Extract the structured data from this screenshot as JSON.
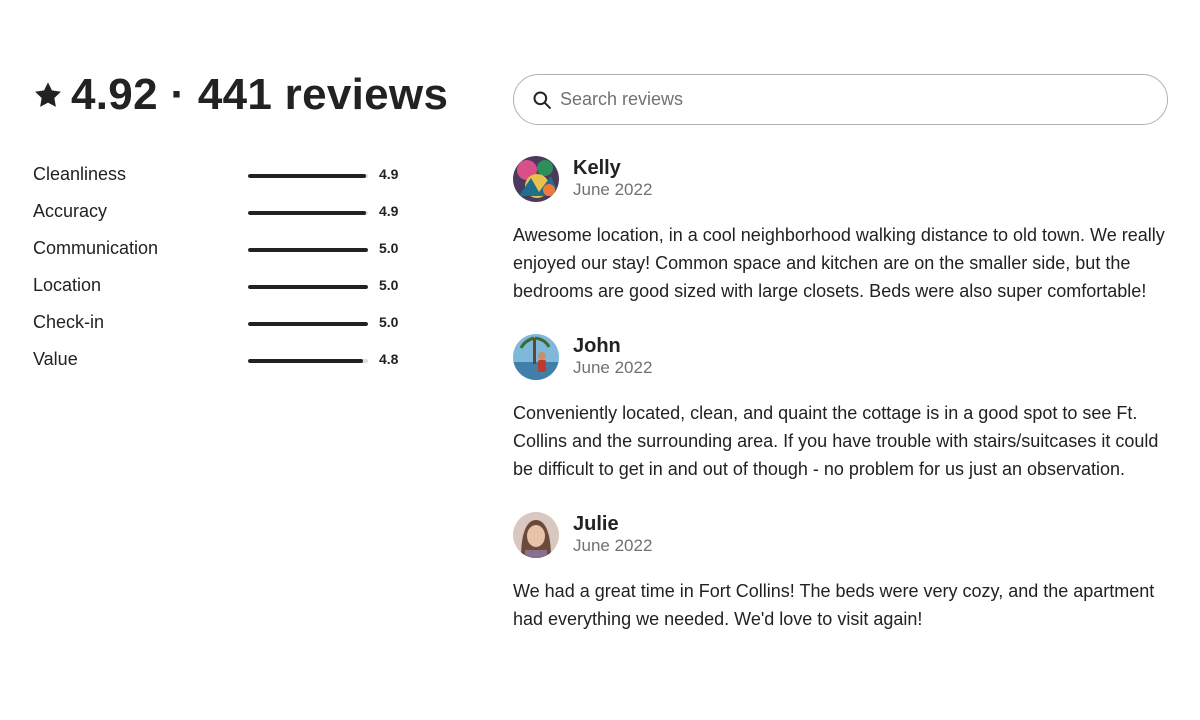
{
  "summary": {
    "headline": "4.92 · 441 reviews",
    "icon": "star-icon"
  },
  "ratings": [
    {
      "label": "Cleanliness",
      "value": "4.9",
      "fraction": 0.98
    },
    {
      "label": "Accuracy",
      "value": "4.9",
      "fraction": 0.98
    },
    {
      "label": "Communication",
      "value": "5.0",
      "fraction": 1.0
    },
    {
      "label": "Location",
      "value": "5.0",
      "fraction": 1.0
    },
    {
      "label": "Check-in",
      "value": "5.0",
      "fraction": 1.0
    },
    {
      "label": "Value",
      "value": "4.8",
      "fraction": 0.96
    }
  ],
  "search": {
    "placeholder": "Search reviews",
    "value": "",
    "icon": "search-icon"
  },
  "reviews": [
    {
      "name": "Kelly",
      "date": "June 2022",
      "text": "Awesome location, in a cool neighborhood walking distance to old town. We really enjoyed our stay! Common space and kitchen are on the smaller side, but the bedrooms are good sized with large closets. Beds were also super comfortable!"
    },
    {
      "name": "John",
      "date": "June 2022",
      "text": "Conveniently located, clean, and quaint the cottage is in a good spot to see Ft. Collins and the surrounding area. If you have trouble with stairs/suitcases it could be difficult to get in and out of though - no problem for us just an observation."
    },
    {
      "name": "Julie",
      "date": "June 2022",
      "text": "We had a great time in Fort Collins! The beds were very cozy, and the apartment had everything we needed. We'd love to visit again!"
    }
  ],
  "colors": {
    "text": "#222222",
    "muted": "#717171",
    "track": "#dddddd",
    "border": "#b0b0b0"
  }
}
